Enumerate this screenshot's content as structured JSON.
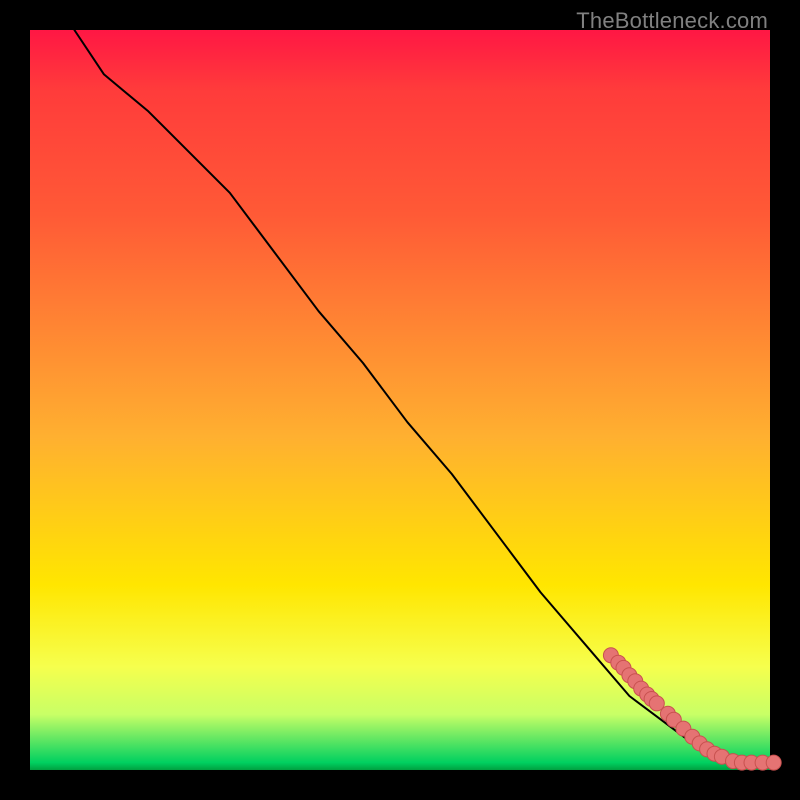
{
  "watermark": "TheBottleneck.com",
  "chart_data": {
    "type": "line",
    "title": "",
    "xlabel": "",
    "ylabel": "",
    "xlim": [
      0,
      100
    ],
    "ylim": [
      0,
      100
    ],
    "grid": false,
    "series": [
      {
        "name": "curve",
        "style": "line",
        "x": [
          6,
          10,
          16,
          22,
          27,
          33,
          39,
          45,
          51,
          57,
          63,
          69,
          75,
          81,
          85,
          89,
          92,
          95,
          98,
          100
        ],
        "y": [
          100,
          94,
          89,
          83,
          78,
          70,
          62,
          55,
          47,
          40,
          32,
          24,
          17,
          10,
          7,
          4,
          2.2,
          1.3,
          1.0,
          1.0
        ]
      },
      {
        "name": "points",
        "style": "scatter",
        "x": [
          78.5,
          79.5,
          80.2,
          81.0,
          81.8,
          82.6,
          83.4,
          84.0,
          84.7,
          86.2,
          87.0,
          88.3,
          89.5,
          90.5,
          91.5,
          92.5,
          93.5,
          95.0,
          96.2,
          97.5,
          99.0,
          100.5
        ],
        "y": [
          15.5,
          14.5,
          13.8,
          12.8,
          12.0,
          11.0,
          10.2,
          9.6,
          9.0,
          7.6,
          6.8,
          5.6,
          4.5,
          3.6,
          2.8,
          2.2,
          1.8,
          1.2,
          1.0,
          1.0,
          1.0,
          1.0
        ]
      }
    ],
    "colors": {
      "line": "#000000",
      "points_fill": "#e57373",
      "points_stroke": "#c8514f"
    }
  }
}
